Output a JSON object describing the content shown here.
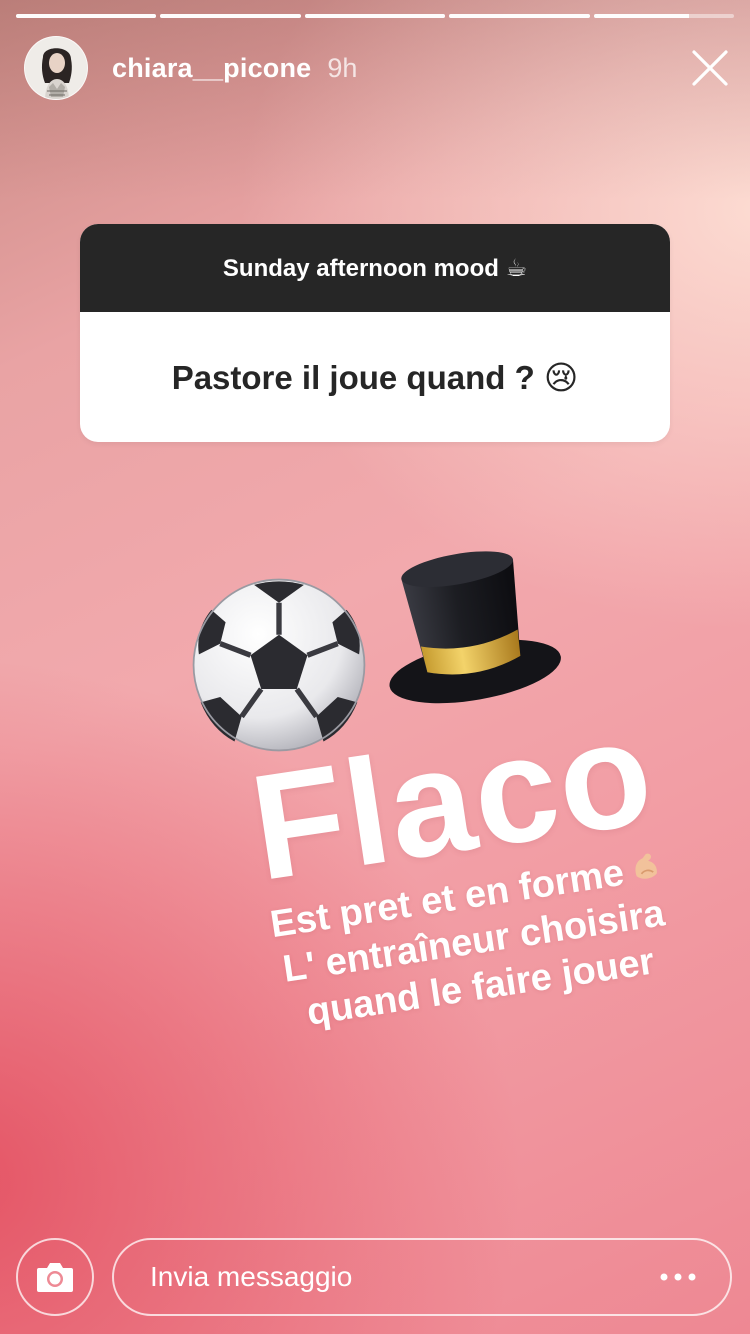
{
  "progress": {
    "segments": [
      1,
      1,
      1,
      1,
      0.68
    ]
  },
  "header": {
    "username": "chiara__picone",
    "timestamp": "9h"
  },
  "question_sticker": {
    "prompt": "Sunday afternoon mood ☕",
    "question": "Pastore il joue quand ? 😢"
  },
  "emojis": [
    "soccer-ball-icon",
    "top-hat-icon"
  ],
  "text_sticker": {
    "title": "Flaco",
    "line1": "Est pret et en forme",
    "line2": "L' entraîneur choisira",
    "line3": "quand le faire jouer"
  },
  "footer": {
    "message_placeholder": "Invia messaggio"
  },
  "colors": {
    "card_header": "#262626",
    "card_body": "#ffffff",
    "text_white": "#ffffff",
    "background_top": "#c98a84",
    "background_bottom": "#ee8893"
  }
}
